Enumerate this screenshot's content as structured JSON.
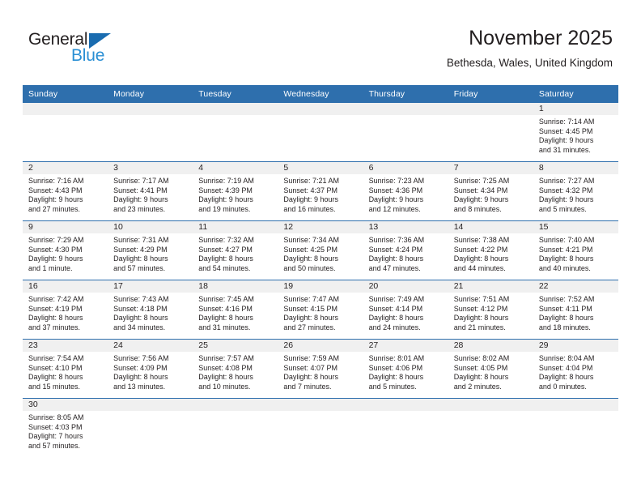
{
  "brand": {
    "name_top": "General",
    "name_bottom": "Blue",
    "flag_icon": "blue-triangle-flag",
    "color_dark": "#231f20",
    "color_blue": "#2a8fd4"
  },
  "header": {
    "title": "November 2025",
    "subtitle": "Bethesda, Wales, United Kingdom",
    "accent_color": "#2e6fad",
    "band_color": "#f0f0f0"
  },
  "weekday_headers": [
    "Sunday",
    "Monday",
    "Tuesday",
    "Wednesday",
    "Thursday",
    "Friday",
    "Saturday"
  ],
  "weeks": [
    [
      {
        "day": "",
        "sunrise": "",
        "sunset": "",
        "daylight_1": "",
        "daylight_2": "",
        "empty": true
      },
      {
        "day": "",
        "sunrise": "",
        "sunset": "",
        "daylight_1": "",
        "daylight_2": "",
        "empty": true
      },
      {
        "day": "",
        "sunrise": "",
        "sunset": "",
        "daylight_1": "",
        "daylight_2": "",
        "empty": true
      },
      {
        "day": "",
        "sunrise": "",
        "sunset": "",
        "daylight_1": "",
        "daylight_2": "",
        "empty": true
      },
      {
        "day": "",
        "sunrise": "",
        "sunset": "",
        "daylight_1": "",
        "daylight_2": "",
        "empty": true
      },
      {
        "day": "",
        "sunrise": "",
        "sunset": "",
        "daylight_1": "",
        "daylight_2": "",
        "empty": true
      },
      {
        "day": "1",
        "sunrise": "Sunrise: 7:14 AM",
        "sunset": "Sunset: 4:45 PM",
        "daylight_1": "Daylight: 9 hours",
        "daylight_2": "and 31 minutes.",
        "empty": false
      }
    ],
    [
      {
        "day": "2",
        "sunrise": "Sunrise: 7:16 AM",
        "sunset": "Sunset: 4:43 PM",
        "daylight_1": "Daylight: 9 hours",
        "daylight_2": "and 27 minutes.",
        "empty": false
      },
      {
        "day": "3",
        "sunrise": "Sunrise: 7:17 AM",
        "sunset": "Sunset: 4:41 PM",
        "daylight_1": "Daylight: 9 hours",
        "daylight_2": "and 23 minutes.",
        "empty": false
      },
      {
        "day": "4",
        "sunrise": "Sunrise: 7:19 AM",
        "sunset": "Sunset: 4:39 PM",
        "daylight_1": "Daylight: 9 hours",
        "daylight_2": "and 19 minutes.",
        "empty": false
      },
      {
        "day": "5",
        "sunrise": "Sunrise: 7:21 AM",
        "sunset": "Sunset: 4:37 PM",
        "daylight_1": "Daylight: 9 hours",
        "daylight_2": "and 16 minutes.",
        "empty": false
      },
      {
        "day": "6",
        "sunrise": "Sunrise: 7:23 AM",
        "sunset": "Sunset: 4:36 PM",
        "daylight_1": "Daylight: 9 hours",
        "daylight_2": "and 12 minutes.",
        "empty": false
      },
      {
        "day": "7",
        "sunrise": "Sunrise: 7:25 AM",
        "sunset": "Sunset: 4:34 PM",
        "daylight_1": "Daylight: 9 hours",
        "daylight_2": "and 8 minutes.",
        "empty": false
      },
      {
        "day": "8",
        "sunrise": "Sunrise: 7:27 AM",
        "sunset": "Sunset: 4:32 PM",
        "daylight_1": "Daylight: 9 hours",
        "daylight_2": "and 5 minutes.",
        "empty": false
      }
    ],
    [
      {
        "day": "9",
        "sunrise": "Sunrise: 7:29 AM",
        "sunset": "Sunset: 4:30 PM",
        "daylight_1": "Daylight: 9 hours",
        "daylight_2": "and 1 minute.",
        "empty": false
      },
      {
        "day": "10",
        "sunrise": "Sunrise: 7:31 AM",
        "sunset": "Sunset: 4:29 PM",
        "daylight_1": "Daylight: 8 hours",
        "daylight_2": "and 57 minutes.",
        "empty": false
      },
      {
        "day": "11",
        "sunrise": "Sunrise: 7:32 AM",
        "sunset": "Sunset: 4:27 PM",
        "daylight_1": "Daylight: 8 hours",
        "daylight_2": "and 54 minutes.",
        "empty": false
      },
      {
        "day": "12",
        "sunrise": "Sunrise: 7:34 AM",
        "sunset": "Sunset: 4:25 PM",
        "daylight_1": "Daylight: 8 hours",
        "daylight_2": "and 50 minutes.",
        "empty": false
      },
      {
        "day": "13",
        "sunrise": "Sunrise: 7:36 AM",
        "sunset": "Sunset: 4:24 PM",
        "daylight_1": "Daylight: 8 hours",
        "daylight_2": "and 47 minutes.",
        "empty": false
      },
      {
        "day": "14",
        "sunrise": "Sunrise: 7:38 AM",
        "sunset": "Sunset: 4:22 PM",
        "daylight_1": "Daylight: 8 hours",
        "daylight_2": "and 44 minutes.",
        "empty": false
      },
      {
        "day": "15",
        "sunrise": "Sunrise: 7:40 AM",
        "sunset": "Sunset: 4:21 PM",
        "daylight_1": "Daylight: 8 hours",
        "daylight_2": "and 40 minutes.",
        "empty": false
      }
    ],
    [
      {
        "day": "16",
        "sunrise": "Sunrise: 7:42 AM",
        "sunset": "Sunset: 4:19 PM",
        "daylight_1": "Daylight: 8 hours",
        "daylight_2": "and 37 minutes.",
        "empty": false
      },
      {
        "day": "17",
        "sunrise": "Sunrise: 7:43 AM",
        "sunset": "Sunset: 4:18 PM",
        "daylight_1": "Daylight: 8 hours",
        "daylight_2": "and 34 minutes.",
        "empty": false
      },
      {
        "day": "18",
        "sunrise": "Sunrise: 7:45 AM",
        "sunset": "Sunset: 4:16 PM",
        "daylight_1": "Daylight: 8 hours",
        "daylight_2": "and 31 minutes.",
        "empty": false
      },
      {
        "day": "19",
        "sunrise": "Sunrise: 7:47 AM",
        "sunset": "Sunset: 4:15 PM",
        "daylight_1": "Daylight: 8 hours",
        "daylight_2": "and 27 minutes.",
        "empty": false
      },
      {
        "day": "20",
        "sunrise": "Sunrise: 7:49 AM",
        "sunset": "Sunset: 4:14 PM",
        "daylight_1": "Daylight: 8 hours",
        "daylight_2": "and 24 minutes.",
        "empty": false
      },
      {
        "day": "21",
        "sunrise": "Sunrise: 7:51 AM",
        "sunset": "Sunset: 4:12 PM",
        "daylight_1": "Daylight: 8 hours",
        "daylight_2": "and 21 minutes.",
        "empty": false
      },
      {
        "day": "22",
        "sunrise": "Sunrise: 7:52 AM",
        "sunset": "Sunset: 4:11 PM",
        "daylight_1": "Daylight: 8 hours",
        "daylight_2": "and 18 minutes.",
        "empty": false
      }
    ],
    [
      {
        "day": "23",
        "sunrise": "Sunrise: 7:54 AM",
        "sunset": "Sunset: 4:10 PM",
        "daylight_1": "Daylight: 8 hours",
        "daylight_2": "and 15 minutes.",
        "empty": false
      },
      {
        "day": "24",
        "sunrise": "Sunrise: 7:56 AM",
        "sunset": "Sunset: 4:09 PM",
        "daylight_1": "Daylight: 8 hours",
        "daylight_2": "and 13 minutes.",
        "empty": false
      },
      {
        "day": "25",
        "sunrise": "Sunrise: 7:57 AM",
        "sunset": "Sunset: 4:08 PM",
        "daylight_1": "Daylight: 8 hours",
        "daylight_2": "and 10 minutes.",
        "empty": false
      },
      {
        "day": "26",
        "sunrise": "Sunrise: 7:59 AM",
        "sunset": "Sunset: 4:07 PM",
        "daylight_1": "Daylight: 8 hours",
        "daylight_2": "and 7 minutes.",
        "empty": false
      },
      {
        "day": "27",
        "sunrise": "Sunrise: 8:01 AM",
        "sunset": "Sunset: 4:06 PM",
        "daylight_1": "Daylight: 8 hours",
        "daylight_2": "and 5 minutes.",
        "empty": false
      },
      {
        "day": "28",
        "sunrise": "Sunrise: 8:02 AM",
        "sunset": "Sunset: 4:05 PM",
        "daylight_1": "Daylight: 8 hours",
        "daylight_2": "and 2 minutes.",
        "empty": false
      },
      {
        "day": "29",
        "sunrise": "Sunrise: 8:04 AM",
        "sunset": "Sunset: 4:04 PM",
        "daylight_1": "Daylight: 8 hours",
        "daylight_2": "and 0 minutes.",
        "empty": false
      }
    ],
    [
      {
        "day": "30",
        "sunrise": "Sunrise: 8:05 AM",
        "sunset": "Sunset: 4:03 PM",
        "daylight_1": "Daylight: 7 hours",
        "daylight_2": "and 57 minutes.",
        "empty": false
      },
      {
        "day": "",
        "sunrise": "",
        "sunset": "",
        "daylight_1": "",
        "daylight_2": "",
        "empty": true
      },
      {
        "day": "",
        "sunrise": "",
        "sunset": "",
        "daylight_1": "",
        "daylight_2": "",
        "empty": true
      },
      {
        "day": "",
        "sunrise": "",
        "sunset": "",
        "daylight_1": "",
        "daylight_2": "",
        "empty": true
      },
      {
        "day": "",
        "sunrise": "",
        "sunset": "",
        "daylight_1": "",
        "daylight_2": "",
        "empty": true
      },
      {
        "day": "",
        "sunrise": "",
        "sunset": "",
        "daylight_1": "",
        "daylight_2": "",
        "empty": true
      },
      {
        "day": "",
        "sunrise": "",
        "sunset": "",
        "daylight_1": "",
        "daylight_2": "",
        "empty": true
      }
    ]
  ]
}
